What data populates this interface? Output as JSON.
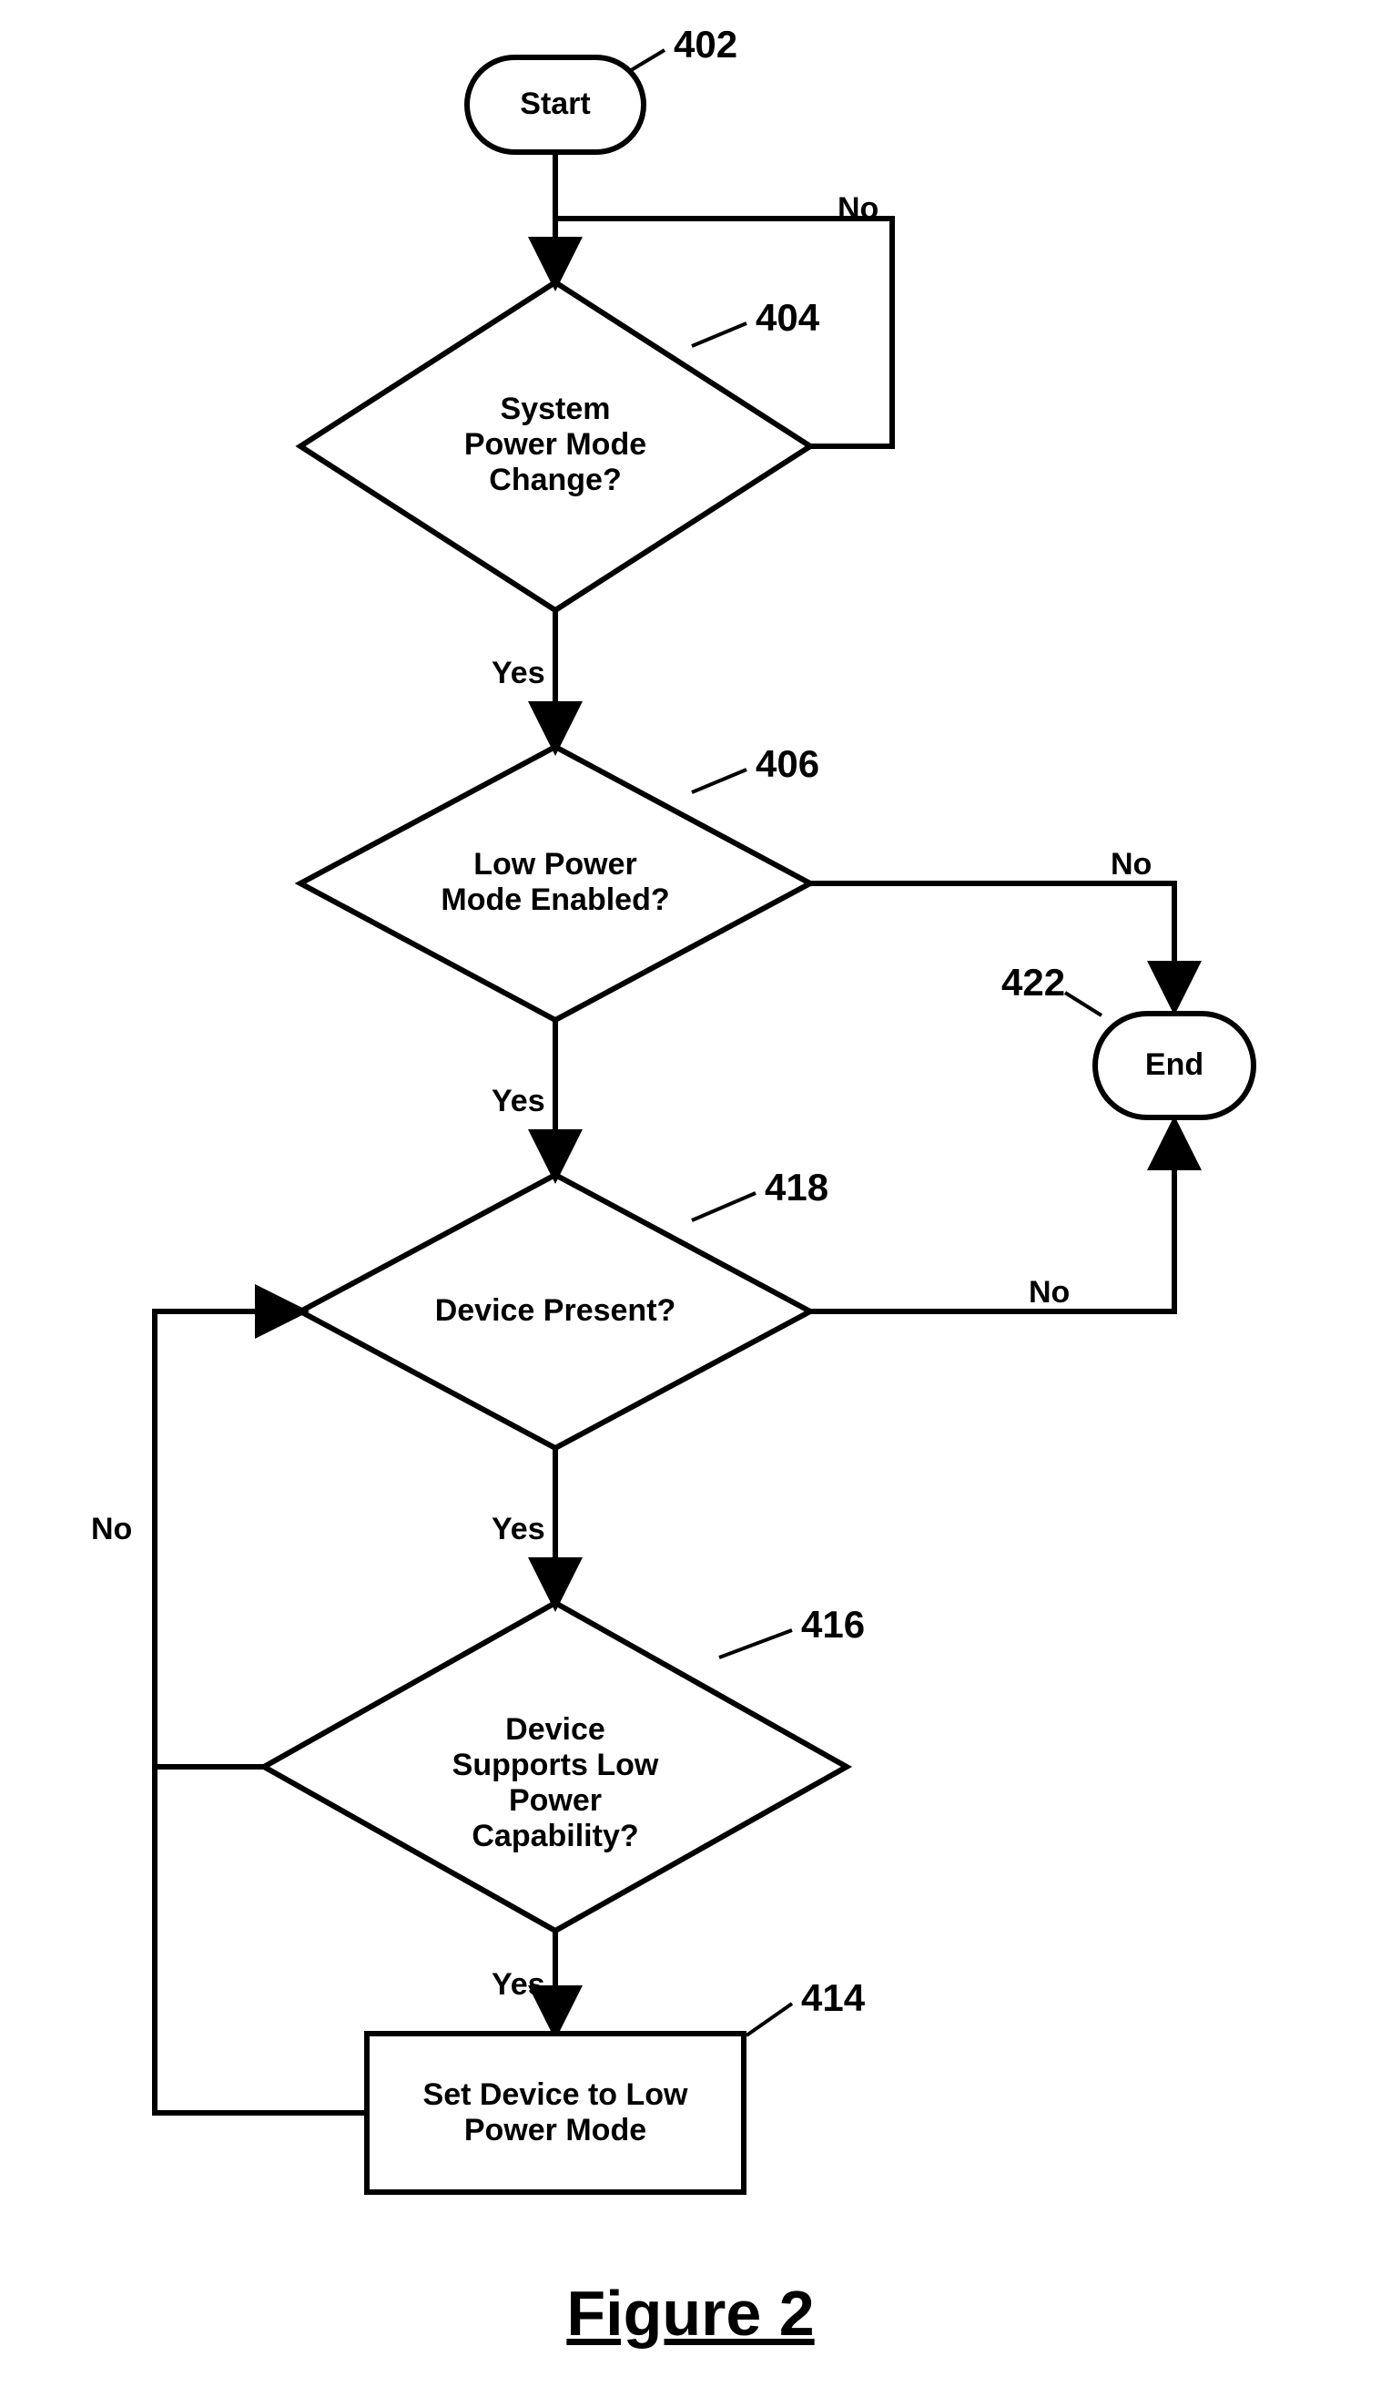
{
  "figure_title": "Figure 2",
  "nodes": {
    "start": {
      "label": "Start",
      "ref": "402"
    },
    "d404": {
      "label": "System\nPower Mode\nChange?",
      "ref": "404"
    },
    "d406": {
      "label": "Low Power\nMode Enabled?",
      "ref": "406"
    },
    "d418": {
      "label": "Device Present?",
      "ref": "418"
    },
    "d416": {
      "label": "Device\nSupports Low Power\nCapability?",
      "ref": "416"
    },
    "p414": {
      "label": "Set Device to Low\nPower Mode",
      "ref": "414"
    },
    "end": {
      "label": "End",
      "ref": "422"
    }
  },
  "edges": {
    "yes": "Yes",
    "no": "No"
  },
  "chart_data": {
    "type": "flowchart",
    "nodes": [
      {
        "id": "402",
        "shape": "terminal",
        "label": "Start"
      },
      {
        "id": "404",
        "shape": "decision",
        "label": "System Power Mode Change?"
      },
      {
        "id": "406",
        "shape": "decision",
        "label": "Low Power Mode Enabled?"
      },
      {
        "id": "418",
        "shape": "decision",
        "label": "Device Present?"
      },
      {
        "id": "416",
        "shape": "decision",
        "label": "Device Supports Low Power Capability?"
      },
      {
        "id": "414",
        "shape": "process",
        "label": "Set Device to Low Power Mode"
      },
      {
        "id": "422",
        "shape": "terminal",
        "label": "End"
      }
    ],
    "edges": [
      {
        "from": "402",
        "to": "404"
      },
      {
        "from": "404",
        "to": "404",
        "label": "No",
        "loop": true
      },
      {
        "from": "404",
        "to": "406",
        "label": "Yes"
      },
      {
        "from": "406",
        "to": "418",
        "label": "Yes"
      },
      {
        "from": "406",
        "to": "422",
        "label": "No"
      },
      {
        "from": "418",
        "to": "416",
        "label": "Yes"
      },
      {
        "from": "418",
        "to": "422",
        "label": "No"
      },
      {
        "from": "416",
        "to": "414",
        "label": "Yes"
      },
      {
        "from": "416",
        "to": "418",
        "label": "No"
      },
      {
        "from": "414",
        "to": "418"
      }
    ]
  }
}
